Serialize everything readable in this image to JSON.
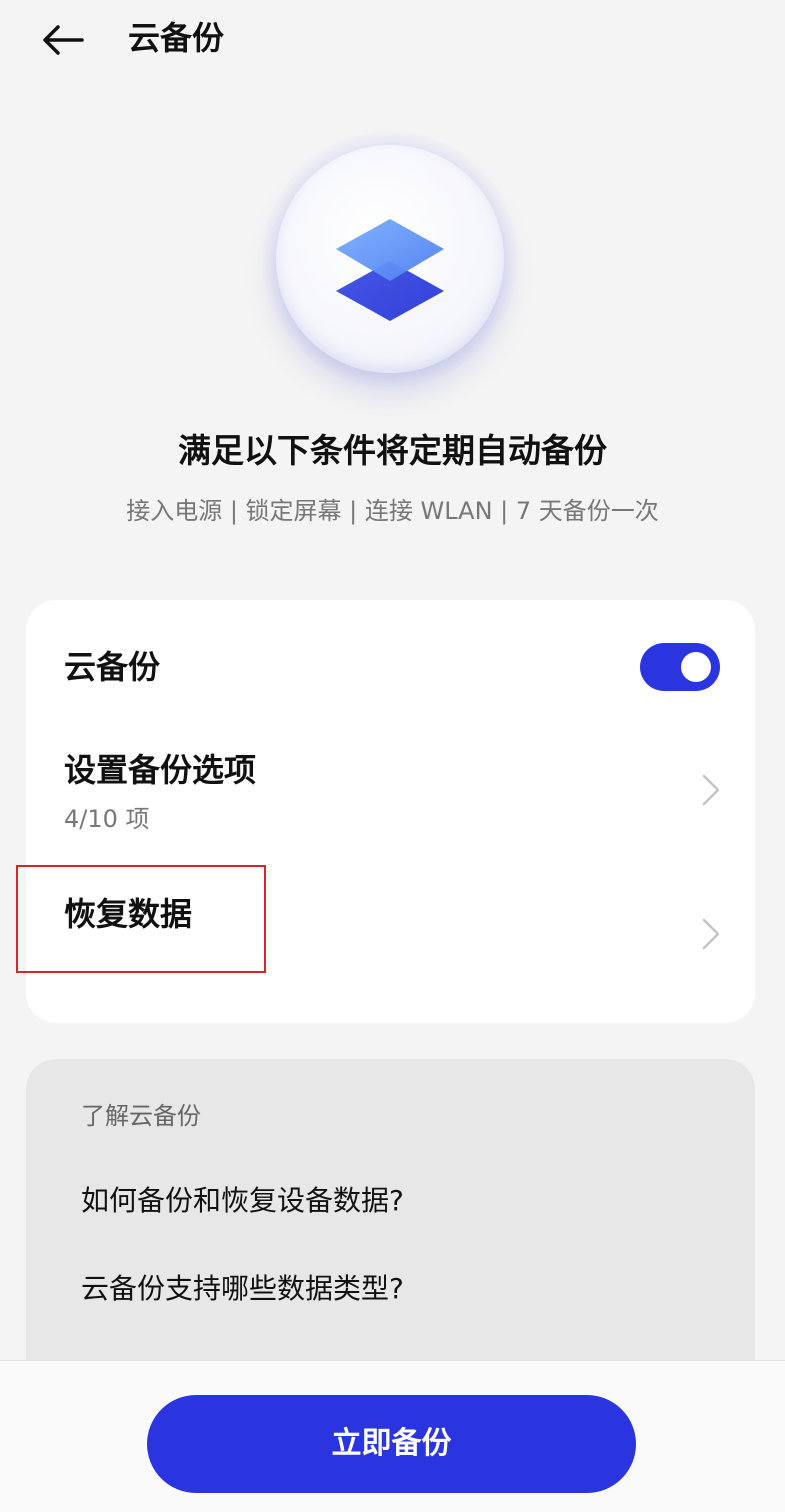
{
  "header": {
    "title": "云备份"
  },
  "hero": {
    "icon": "layers-icon"
  },
  "intro": {
    "headline": "满足以下条件将定期自动备份",
    "conditions": "接入电源 | 锁定屏幕 | 连接 WLAN | 7 天备份一次"
  },
  "settings": {
    "cloud_backup": {
      "label": "云备份",
      "enabled": true
    },
    "backup_options": {
      "label": "设置备份选项",
      "sub": "4/10 项"
    },
    "restore": {
      "label": "恢复数据"
    }
  },
  "faq": {
    "title": "了解云备份",
    "items": [
      "如何备份和恢复设备数据?",
      "云备份支持哪些数据类型?"
    ]
  },
  "footer": {
    "button_label": "立即备份"
  },
  "colors": {
    "accent": "#2a35e0",
    "highlight": "#d8252a"
  }
}
